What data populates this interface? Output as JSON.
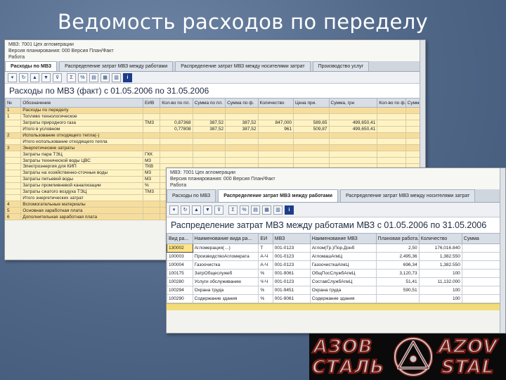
{
  "slide": {
    "title": "Ведомость расходов по переделу"
  },
  "window1": {
    "header_lines": [
      "МВЗ: 7001 Цех агломерации",
      "Версия планирования: 000 Версия План/Факт",
      "Работа"
    ],
    "tabs": [
      {
        "label": "Расходы по МВЗ",
        "active": true
      },
      {
        "label": "Распределение затрат МВЗ между работами",
        "active": false
      },
      {
        "label": "Распределение затрат МВЗ между носителями затрат",
        "active": false
      },
      {
        "label": "Производство услуг",
        "active": false
      }
    ],
    "report_title": "Расходы по МВЗ (факт) с 01.05.2006 по 31.05.2006",
    "columns": [
      "№",
      "Обозначение",
      "ЕИВ",
      "Кол-во по пл.",
      "Сумма по пл.",
      "Сумма по ф.",
      "Количество",
      "Цена при.",
      "Сумма, грн",
      "Кол-во по ф.",
      "Сумма"
    ],
    "rows": [
      {
        "no": "1",
        "name": "Расходы по переделу",
        "unit": "",
        "v1": "",
        "v2": "",
        "v3": "",
        "v4": "",
        "v5": "",
        "v6": "",
        "lvl": 0
      },
      {
        "no": "1",
        "name": "Топливо технологическое",
        "unit": "",
        "v1": "",
        "v2": "",
        "v3": "",
        "v4": "",
        "v5": "",
        "v6": "",
        "lvl": 1
      },
      {
        "no": "",
        "name": "Затраты природного газа",
        "unit": "ТМ3",
        "v1": "0,87368",
        "v2": "387,52",
        "v3": "387,52",
        "v4": "847,000",
        "v5": "589,65",
        "v6": "499,650,41",
        "lvl": 1
      },
      {
        "no": "",
        "name": "Итого в условном",
        "unit": "",
        "v1": "0,77808",
        "v2": "387,52",
        "v3": "387,52",
        "v4": "961",
        "v5": "509,87",
        "v6": "499,650,41",
        "lvl": 1
      },
      {
        "no": "2",
        "name": "Использование отходящего тепла(-)",
        "unit": "",
        "v1": "",
        "v2": "",
        "v3": "",
        "v4": "",
        "v5": "",
        "v6": "",
        "lvl": 0
      },
      {
        "no": "",
        "name": "Итого использование отходящего тепла",
        "unit": "",
        "v1": "",
        "v2": "",
        "v3": "",
        "v4": "",
        "v5": "",
        "v6": "",
        "lvl": 1
      },
      {
        "no": "3",
        "name": "Энергетические затраты",
        "unit": "",
        "v1": "",
        "v2": "",
        "v3": "",
        "v4": "",
        "v5": "",
        "v6": "",
        "lvl": 0
      },
      {
        "no": "",
        "name": "Затраты пара ТЭЦ",
        "unit": "ГКК",
        "v1": "",
        "v2": "",
        "v3": "",
        "v4": "",
        "v5": "",
        "v6": "",
        "lvl": 1
      },
      {
        "no": "",
        "name": "Затраты технической воды ЦВС",
        "unit": "М3",
        "v1": "",
        "v2": "",
        "v3": "",
        "v4": "",
        "v5": "",
        "v6": "",
        "lvl": 1
      },
      {
        "no": "",
        "name": "Электроэнергия для КИП",
        "unit": "ТКВ",
        "v1": "",
        "v2": "",
        "v3": "",
        "v4": "",
        "v5": "",
        "v6": "",
        "lvl": 1
      },
      {
        "no": "",
        "name": "Затраты на хозяйственно-сточные воды",
        "unit": "М3",
        "v1": "",
        "v2": "",
        "v3": "",
        "v4": "",
        "v5": "",
        "v6": "",
        "lvl": 1
      },
      {
        "no": "",
        "name": "Затраты питьевой воды",
        "unit": "М3",
        "v1": "",
        "v2": "",
        "v3": "",
        "v4": "",
        "v5": "",
        "v6": "",
        "lvl": 1
      },
      {
        "no": "",
        "name": "Затраты промливневой канализации",
        "unit": "%",
        "v1": "",
        "v2": "",
        "v3": "",
        "v4": "",
        "v5": "",
        "v6": "",
        "lvl": 1
      },
      {
        "no": "",
        "name": "Затраты сжатого воздуха ТЭЦ",
        "unit": "ТМ3",
        "v1": "",
        "v2": "",
        "v3": "",
        "v4": "",
        "v5": "",
        "v6": "",
        "lvl": 1
      },
      {
        "no": "",
        "name": "Итого энергетических затрат",
        "unit": "",
        "v1": "",
        "v2": "",
        "v3": "",
        "v4": "",
        "v5": "",
        "v6": "",
        "lvl": 1
      },
      {
        "no": "4",
        "name": "Вспомогательные материалы",
        "unit": "",
        "v1": "",
        "v2": "",
        "v3": "",
        "v4": "",
        "v5": "",
        "v6": "",
        "lvl": 0
      },
      {
        "no": "5",
        "name": "Основная заработная плата",
        "unit": "",
        "v1": "",
        "v2": "",
        "v3": "",
        "v4": "",
        "v5": "",
        "v6": "",
        "lvl": 0
      },
      {
        "no": "6",
        "name": "Дополнительная заработная плата",
        "unit": "",
        "v1": "",
        "v2": "",
        "v3": "",
        "v4": "",
        "v5": "",
        "v6": "",
        "lvl": 0
      }
    ]
  },
  "window2": {
    "header_lines": [
      "МВЗ: 7001 Цех агломерации",
      "Версия планирования: 000 Версия План/Факт",
      "Работа"
    ],
    "tabs": [
      {
        "label": "Расходы по МВЗ",
        "active": false
      },
      {
        "label": "Распределение затрат МВЗ между работами",
        "active": true
      },
      {
        "label": "Распределение затрат МВЗ между носителями затрат",
        "active": false
      }
    ],
    "report_title": "Распределение затрат МВЗ между работами МВЗ с 01.05.2006 по 31.05.2006",
    "columns": [
      "Вид ра...",
      "Наименование вида ра...",
      "ЕИ",
      "МВЗ",
      "Наименование МВЗ",
      "Плановая работа...",
      "Количество",
      "Сумма"
    ],
    "rows": [
      {
        "code": "130002",
        "name": "Агломерация(…)",
        "ei": "Т",
        "mvz": "001-0123",
        "mvz_name": "Аглом(Гр.)Пор.Донб",
        "plan": "2,50",
        "qty": "176,016.840",
        "sum": ""
      },
      {
        "code": "100003",
        "name": "ПроизводствоАгломерата",
        "ei": "А-Ч",
        "mvz": "001-0123",
        "mvz_name": "АгломашАгмЦ",
        "plan": "2,495,36",
        "qty": "1,382.550",
        "sum": ""
      },
      {
        "code": "100004",
        "name": "Газоочистка",
        "ei": "А-Ч",
        "mvz": "001-0123",
        "mvz_name": "ГазоочисткаАгмЦ",
        "plan": "696,34",
        "qty": "1,382.550",
        "sum": ""
      },
      {
        "code": "100175",
        "name": "ЗатрОбщеслужеб",
        "ei": "%",
        "mvz": "001-9061",
        "mvz_name": "ОбщПосСлужбАгмЦ",
        "plan": "3,120,73",
        "qty": "100",
        "sum": ""
      },
      {
        "code": "100280",
        "name": "Услуги обслуживанию",
        "ei": "Ч-Ч",
        "mvz": "001-0123",
        "mvz_name": "СоставСлужбАгмЦ",
        "plan": "51,41",
        "qty": "11,132.000",
        "sum": ""
      },
      {
        "code": "100294",
        "name": "Охрана труда",
        "ei": "%",
        "mvz": "001-9451",
        "mvz_name": "Охрана труда",
        "plan": "590,51",
        "qty": "100",
        "sum": ""
      },
      {
        "code": "100290",
        "name": "Содержание здания",
        "ei": "%",
        "mvz": "001-9061",
        "mvz_name": "Содержание здания",
        "plan": "",
        "qty": "100",
        "sum": ""
      }
    ]
  },
  "toolbar_icons": [
    "expand-icon",
    "refresh-icon",
    "sort-asc-icon",
    "sort-desc-icon",
    "filter-icon",
    "sum-icon",
    "subtotal-icon",
    "print-icon",
    "excel-icon",
    "layout-icon",
    "info-icon"
  ],
  "logo": {
    "left_top": "АЗОВ",
    "left_bottom": "СТАЛЬ",
    "right_top": "AZOV",
    "right_bottom": "STAL",
    "color_text": "#c7c7c7",
    "color_outline": "#7a1a14"
  }
}
